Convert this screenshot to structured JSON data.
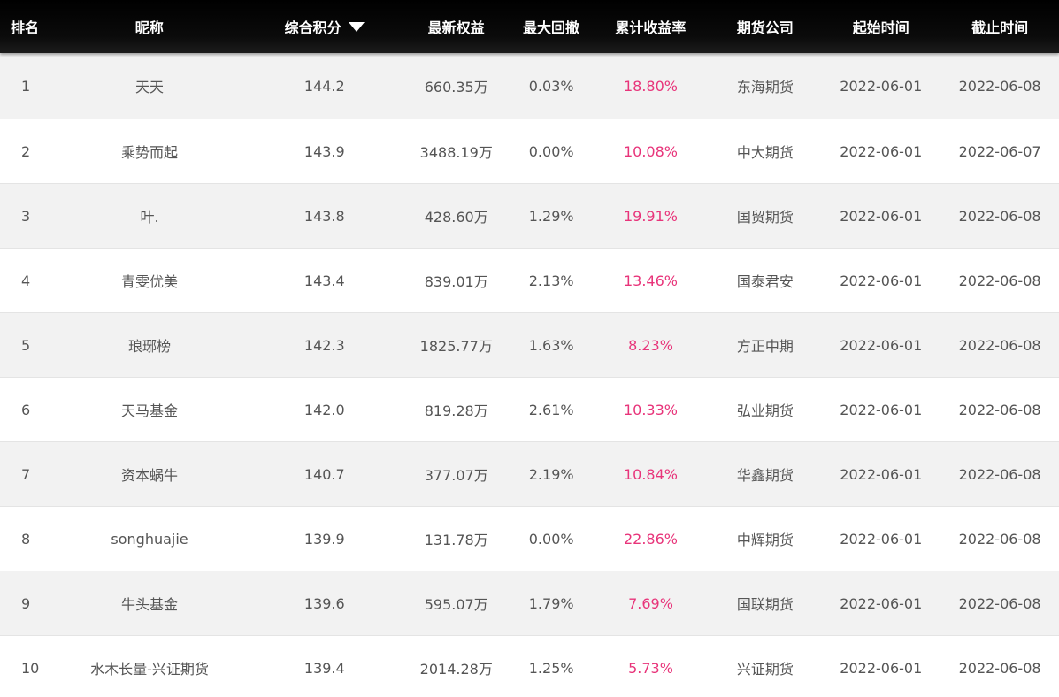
{
  "header": {
    "rank": "排名",
    "nickname": "昵称",
    "score": "综合积分",
    "equity": "最新权益",
    "drawdown": "最大回撤",
    "return": "累计收益率",
    "company": "期货公司",
    "start": "起始时间",
    "end": "截止时间",
    "sort_icon": "triangle-down-icon"
  },
  "colors": {
    "header_bg": "#000000",
    "return_text": "#e8347a",
    "row_alt_bg": "#f2f2f2",
    "text": "#555555"
  },
  "rows": [
    {
      "rank": "1",
      "nickname": "天天",
      "score": "144.2",
      "equity": "660.35万",
      "drawdown": "0.03%",
      "return": "18.80%",
      "company": "东海期货",
      "start": "2022-06-01",
      "end": "2022-06-08"
    },
    {
      "rank": "2",
      "nickname": "乘势而起",
      "score": "143.9",
      "equity": "3488.19万",
      "drawdown": "0.00%",
      "return": "10.08%",
      "company": "中大期货",
      "start": "2022-06-01",
      "end": "2022-06-07"
    },
    {
      "rank": "3",
      "nickname": "叶.",
      "score": "143.8",
      "equity": "428.60万",
      "drawdown": "1.29%",
      "return": "19.91%",
      "company": "国贸期货",
      "start": "2022-06-01",
      "end": "2022-06-08"
    },
    {
      "rank": "4",
      "nickname": "青雯优美",
      "score": "143.4",
      "equity": "839.01万",
      "drawdown": "2.13%",
      "return": "13.46%",
      "company": "国泰君安",
      "start": "2022-06-01",
      "end": "2022-06-08"
    },
    {
      "rank": "5",
      "nickname": "琅琊榜",
      "score": "142.3",
      "equity": "1825.77万",
      "drawdown": "1.63%",
      "return": "8.23%",
      "company": "方正中期",
      "start": "2022-06-01",
      "end": "2022-06-08"
    },
    {
      "rank": "6",
      "nickname": "天马基金",
      "score": "142.0",
      "equity": "819.28万",
      "drawdown": "2.61%",
      "return": "10.33%",
      "company": "弘业期货",
      "start": "2022-06-01",
      "end": "2022-06-08"
    },
    {
      "rank": "7",
      "nickname": "资本蜗牛",
      "score": "140.7",
      "equity": "377.07万",
      "drawdown": "2.19%",
      "return": "10.84%",
      "company": "华鑫期货",
      "start": "2022-06-01",
      "end": "2022-06-08"
    },
    {
      "rank": "8",
      "nickname": "songhuajie",
      "score": "139.9",
      "equity": "131.78万",
      "drawdown": "0.00%",
      "return": "22.86%",
      "company": "中辉期货",
      "start": "2022-06-01",
      "end": "2022-06-08"
    },
    {
      "rank": "9",
      "nickname": "牛头基金",
      "score": "139.6",
      "equity": "595.07万",
      "drawdown": "1.79%",
      "return": "7.69%",
      "company": "国联期货",
      "start": "2022-06-01",
      "end": "2022-06-08"
    },
    {
      "rank": "10",
      "nickname": "水木长量-兴证期货",
      "score": "139.4",
      "equity": "2014.28万",
      "drawdown": "1.25%",
      "return": "5.73%",
      "company": "兴证期货",
      "start": "2022-06-01",
      "end": "2022-06-08"
    }
  ]
}
